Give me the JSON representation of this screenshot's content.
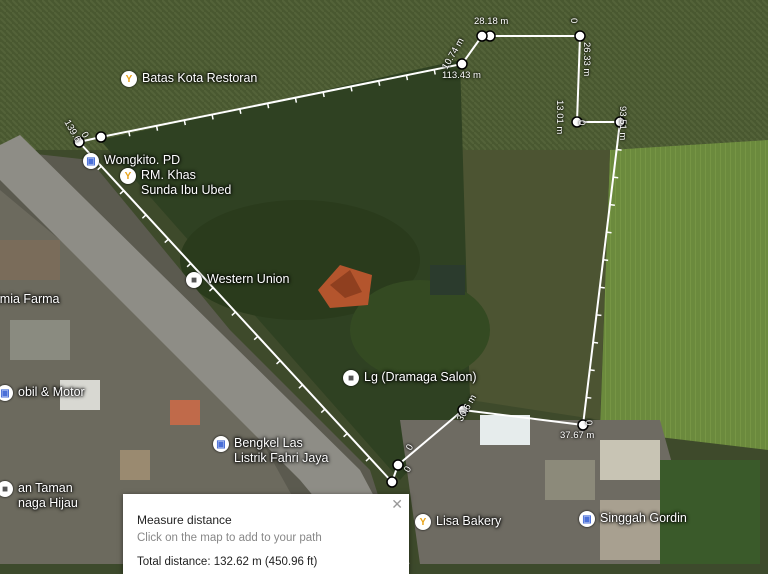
{
  "pois": [
    {
      "id": "batas-kota",
      "lines": [
        "Batas Kota Restoran"
      ],
      "type": "food",
      "icon": "restaurant-icon"
    },
    {
      "id": "wongkito",
      "lines": [
        "Wongkito. PD"
      ],
      "type": "shop",
      "icon": "shopping-bag-icon"
    },
    {
      "id": "rm-khas",
      "lines": [
        "RM. Khas",
        "Sunda Ibu Ubed"
      ],
      "type": "food",
      "icon": "restaurant-icon"
    },
    {
      "id": "western-union",
      "lines": [
        "Western Union"
      ],
      "type": "svc",
      "icon": "square-pin-icon"
    },
    {
      "id": "kimia-farma",
      "lines": [
        "imia Farma"
      ],
      "type": "none",
      "icon": ""
    },
    {
      "id": "mobil-motor",
      "lines": [
        "obil & Motor"
      ],
      "type": "shop",
      "icon": "shopping-bag-icon"
    },
    {
      "id": "lg-salon",
      "lines": [
        "Lg (Dramaga Salon)"
      ],
      "type": "svc",
      "icon": "square-pin-icon"
    },
    {
      "id": "bengkel-las",
      "lines": [
        "Bengkel Las",
        "Listrik Fahri Jaya"
      ],
      "type": "shop",
      "icon": "shopping-bag-icon"
    },
    {
      "id": "taman",
      "lines": [
        "an Taman",
        "naga Hijau"
      ],
      "type": "svc",
      "icon": "pin-icon"
    },
    {
      "id": "lisa-bakery",
      "lines": [
        "Lisa Bakery"
      ],
      "type": "food",
      "icon": "restaurant-icon"
    },
    {
      "id": "singgah-gordin",
      "lines": [
        "Singgah Gordin"
      ],
      "type": "shop",
      "icon": "shopping-bag-icon"
    }
  ],
  "measure_labels": [
    "28.18 m",
    "0",
    "26.33 m",
    "10.74 m",
    "113.43 m",
    "13.01 m",
    "0",
    "93.51 m",
    "139.6",
    "0",
    "37.67 m",
    "0",
    "30.6 m",
    "0",
    "0"
  ],
  "panel": {
    "title": "Measure distance",
    "hint": "Click on the map to add to your path",
    "total": "Total distance: 132.62 m (450.96 ft)",
    "close": "✕"
  },
  "colors": {
    "path": "#ffffff",
    "node_fill": "#ffffff",
    "node_stroke": "#000000"
  }
}
